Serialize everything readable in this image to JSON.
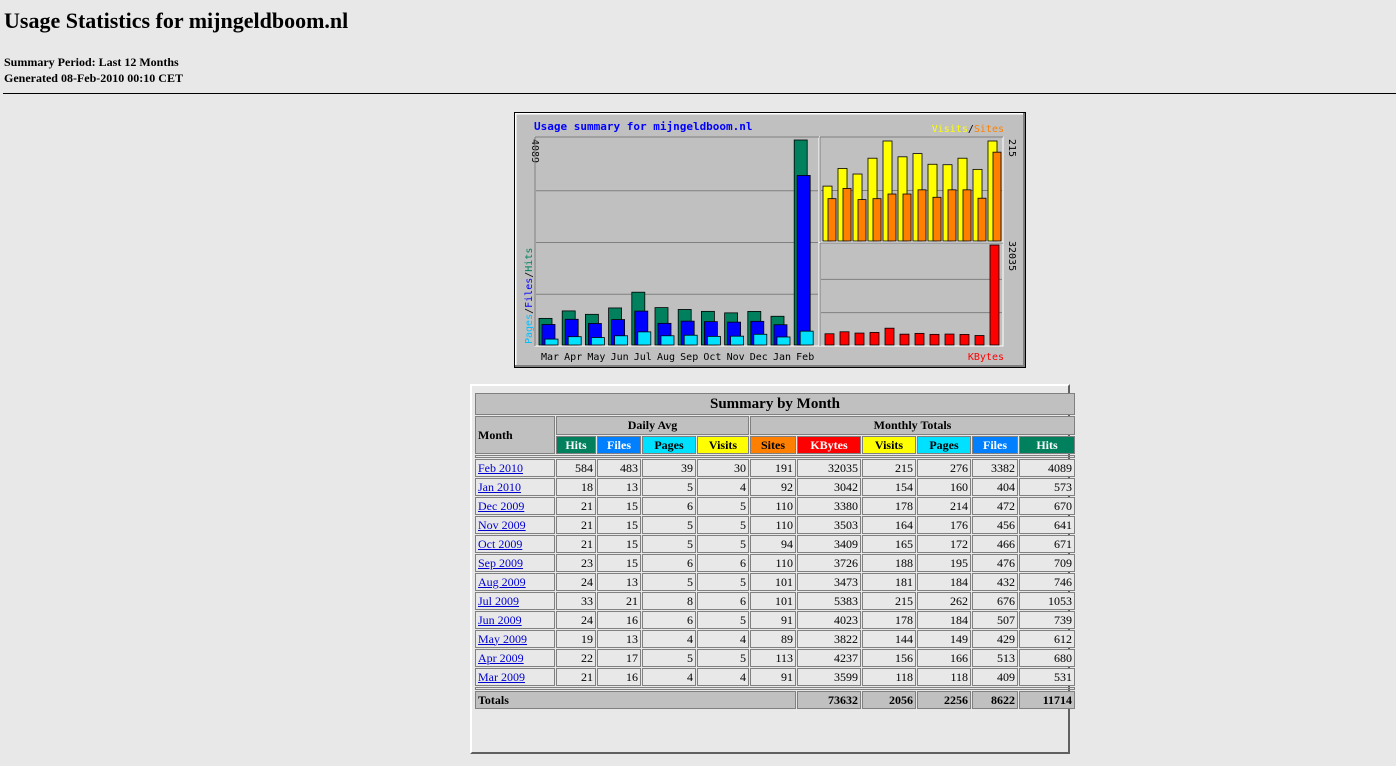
{
  "header": {
    "title": "Usage Statistics for mijngeldboom.nl",
    "period": "Summary Period: Last 12 Months",
    "generated": "Generated 08-Feb-2010 00:10 CET"
  },
  "colors": {
    "hits": "#00805c",
    "files": "#0000ff",
    "files_header": "#0080ff",
    "pages": "#00e0ff",
    "visits": "#ffff00",
    "sites": "#ff8000",
    "kbytes": "#ff0000",
    "chart_bg": "#c0c0c0",
    "title_blue": "#0000ff"
  },
  "chart_data": {
    "type": "bar",
    "title": "Usage summary for mijngeldboom.nl",
    "categories": [
      "Mar",
      "Apr",
      "May",
      "Jun",
      "Jul",
      "Aug",
      "Sep",
      "Oct",
      "Nov",
      "Dec",
      "Jan",
      "Feb"
    ],
    "left_axis_label": [
      "Pages",
      "Files",
      "Hits"
    ],
    "left_max_label": "4089",
    "left_series": [
      {
        "name": "Hits",
        "values": [
          531,
          680,
          612,
          739,
          1053,
          746,
          709,
          671,
          641,
          670,
          573,
          4089
        ]
      },
      {
        "name": "Files",
        "values": [
          409,
          513,
          429,
          507,
          676,
          432,
          476,
          466,
          456,
          472,
          404,
          3382
        ]
      },
      {
        "name": "Pages",
        "values": [
          118,
          166,
          149,
          184,
          262,
          184,
          195,
          172,
          176,
          214,
          160,
          276
        ]
      }
    ],
    "top_right_legend": [
      "Visits",
      "Sites"
    ],
    "top_right_max_label": "215",
    "top_right_series": [
      {
        "name": "Visits",
        "values": [
          118,
          156,
          144,
          178,
          215,
          181,
          188,
          165,
          164,
          178,
          154,
          215
        ]
      },
      {
        "name": "Sites",
        "values": [
          91,
          113,
          89,
          91,
          101,
          101,
          110,
          94,
          110,
          110,
          92,
          191
        ]
      }
    ],
    "bottom_right_legend": "KBytes",
    "bottom_right_max_label": "32035",
    "bottom_right_series": [
      {
        "name": "KBytes",
        "values": [
          3599,
          4237,
          3822,
          4023,
          5383,
          3473,
          3726,
          3409,
          3503,
          3380,
          3042,
          32035
        ]
      }
    ]
  },
  "table": {
    "caption": "Summary by Month",
    "month_header": "Month",
    "daily_avg_header": "Daily Avg",
    "monthly_totals_header": "Monthly Totals",
    "daily_cols": [
      "Hits",
      "Files",
      "Pages",
      "Visits"
    ],
    "monthly_cols": [
      "Sites",
      "KBytes",
      "Visits",
      "Pages",
      "Files",
      "Hits"
    ],
    "rows": [
      {
        "month": "Feb 2010",
        "d": [
          "584",
          "483",
          "39",
          "30"
        ],
        "m": [
          "191",
          "32035",
          "215",
          "276",
          "3382",
          "4089"
        ]
      },
      {
        "month": "Jan 2010",
        "d": [
          "18",
          "13",
          "5",
          "4"
        ],
        "m": [
          "92",
          "3042",
          "154",
          "160",
          "404",
          "573"
        ]
      },
      {
        "month": "Dec 2009",
        "d": [
          "21",
          "15",
          "6",
          "5"
        ],
        "m": [
          "110",
          "3380",
          "178",
          "214",
          "472",
          "670"
        ]
      },
      {
        "month": "Nov 2009",
        "d": [
          "21",
          "15",
          "5",
          "5"
        ],
        "m": [
          "110",
          "3503",
          "164",
          "176",
          "456",
          "641"
        ]
      },
      {
        "month": "Oct 2009",
        "d": [
          "21",
          "15",
          "5",
          "5"
        ],
        "m": [
          "94",
          "3409",
          "165",
          "172",
          "466",
          "671"
        ]
      },
      {
        "month": "Sep 2009",
        "d": [
          "23",
          "15",
          "6",
          "6"
        ],
        "m": [
          "110",
          "3726",
          "188",
          "195",
          "476",
          "709"
        ]
      },
      {
        "month": "Aug 2009",
        "d": [
          "24",
          "13",
          "5",
          "5"
        ],
        "m": [
          "101",
          "3473",
          "181",
          "184",
          "432",
          "746"
        ]
      },
      {
        "month": "Jul 2009",
        "d": [
          "33",
          "21",
          "8",
          "6"
        ],
        "m": [
          "101",
          "5383",
          "215",
          "262",
          "676",
          "1053"
        ]
      },
      {
        "month": "Jun 2009",
        "d": [
          "24",
          "16",
          "6",
          "5"
        ],
        "m": [
          "91",
          "4023",
          "178",
          "184",
          "507",
          "739"
        ]
      },
      {
        "month": "May 2009",
        "d": [
          "19",
          "13",
          "4",
          "4"
        ],
        "m": [
          "89",
          "3822",
          "144",
          "149",
          "429",
          "612"
        ]
      },
      {
        "month": "Apr 2009",
        "d": [
          "22",
          "17",
          "5",
          "5"
        ],
        "m": [
          "113",
          "4237",
          "156",
          "166",
          "513",
          "680"
        ]
      },
      {
        "month": "Mar 2009",
        "d": [
          "21",
          "16",
          "4",
          "4"
        ],
        "m": [
          "91",
          "3599",
          "118",
          "118",
          "409",
          "531"
        ]
      }
    ],
    "totals_label": "Totals",
    "totals": [
      "73632",
      "2056",
      "2256",
      "8622",
      "11714"
    ]
  }
}
